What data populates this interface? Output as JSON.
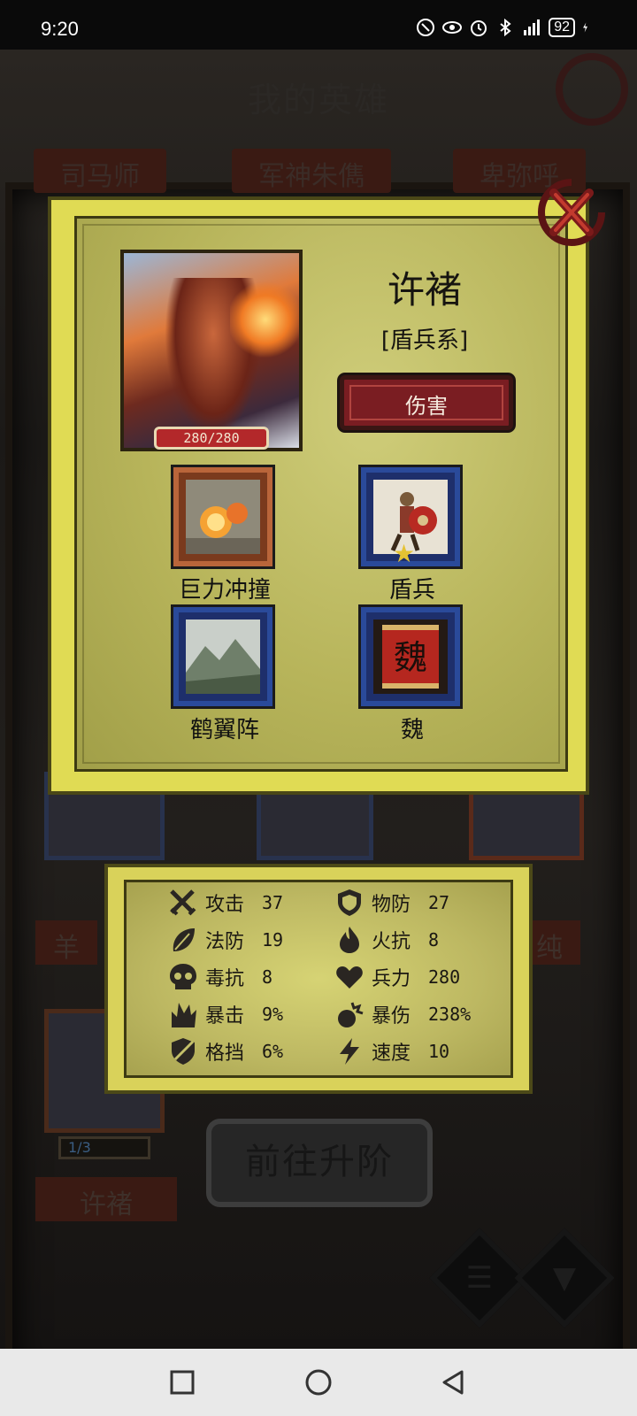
{
  "status_bar": {
    "time": "9:20",
    "battery": "92"
  },
  "background": {
    "title": "我的英雄",
    "tabs": [
      "司马师",
      "军神朱儁",
      "卑弥呼"
    ],
    "side_names": [
      "羊",
      "纯"
    ],
    "hero_card": {
      "progress": "1/3",
      "name": "许褚"
    },
    "advance_button": "前往升阶"
  },
  "hero": {
    "name": "许褚",
    "class": "[盾兵系]",
    "role": "伤害",
    "hp": "280/280",
    "skills": [
      {
        "label": "巨力冲撞",
        "icon": "fire-boulder-icon"
      },
      {
        "label": "盾兵",
        "icon": "shield-soldier-icon"
      },
      {
        "label": "鹤翼阵",
        "icon": "mountain-formation-icon"
      },
      {
        "label": "魏",
        "icon": "wei-banner-icon",
        "glyph": "魏"
      }
    ]
  },
  "stats": [
    {
      "name": "攻击",
      "value": "37",
      "icon": "swords-icon"
    },
    {
      "name": "物防",
      "value": "27",
      "icon": "shield-icon"
    },
    {
      "name": "法防",
      "value": "19",
      "icon": "leaf-icon"
    },
    {
      "name": "火抗",
      "value": "8",
      "icon": "flame-icon"
    },
    {
      "name": "毒抗",
      "value": "8",
      "icon": "skull-icon"
    },
    {
      "name": "兵力",
      "value": "280",
      "icon": "heart-icon"
    },
    {
      "name": "暴击",
      "value": "9%",
      "icon": "claw-icon"
    },
    {
      "name": "暴伤",
      "value": "238%",
      "icon": "burst-icon"
    },
    {
      "name": "格挡",
      "value": "6%",
      "icon": "block-shield-icon"
    },
    {
      "name": "速度",
      "value": "10",
      "icon": "lightning-icon"
    }
  ],
  "colors": {
    "panel": "#e0db54",
    "badge": "#7a1d22",
    "hp": "#b3282a",
    "skill_border_blue": "#2a4a9a",
    "skill_border_orange": "#b9653a"
  }
}
